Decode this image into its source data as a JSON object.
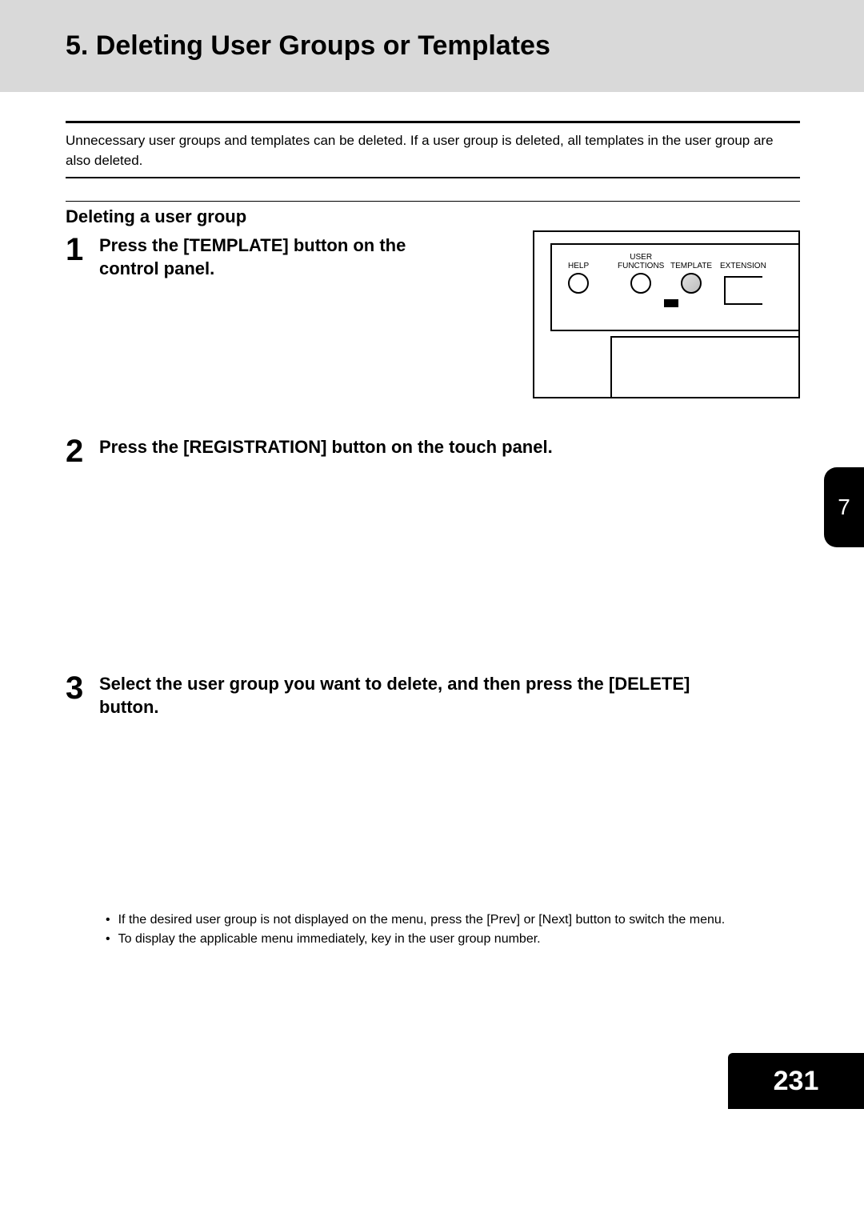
{
  "section_title": "5. Deleting User Groups or Templates",
  "intro": "Unnecessary user groups and templates can be deleted. If a user group is deleted, all templates in the user group are also deleted.",
  "subheading": "Deleting a user group",
  "steps": {
    "s1": {
      "num": "1",
      "text": "Press the [TEMPLATE] button on the control panel."
    },
    "s2": {
      "num": "2",
      "text": "Press the [REGISTRATION] button on the touch panel."
    },
    "s3": {
      "num": "3",
      "text": "Select the user group you want to delete, and then press the [DELETE] button."
    }
  },
  "panel": {
    "help_label": "HELP",
    "user_label": "USER",
    "functions_label": "FUNCTIONS",
    "template_label": "TEMPLATE",
    "extension_label": "EXTENSION"
  },
  "notes": {
    "n1": "If the desired user group is not displayed on the menu, press the [Prev] or [Next] button to switch the menu.",
    "n2": "To display the applicable menu immediately, key in the user group number."
  },
  "chapter_tab": "7",
  "page_number": "231"
}
